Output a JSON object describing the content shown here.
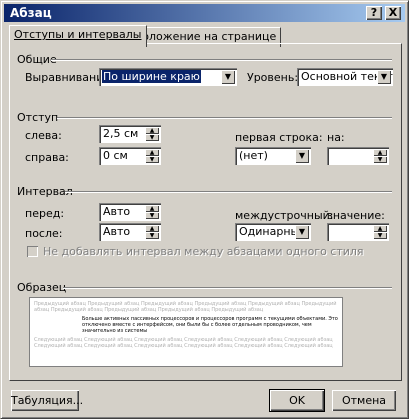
{
  "window": {
    "title": "Абзац",
    "help_btn": "?",
    "close_btn": "X"
  },
  "tabs": [
    {
      "label": "Отступы и интервалы",
      "active": true
    },
    {
      "label": "Положение на странице",
      "active": false
    }
  ],
  "general": {
    "section": "Общие",
    "alignment_label": "Выравнивание:",
    "alignment_value": "По ширине краю",
    "level_label": "Уровень:",
    "level_value": "Основной текст"
  },
  "indent": {
    "section": "Отступ",
    "left_label": "слева:",
    "left_value": "2,5 см",
    "right_label": "справа:",
    "right_value": "0 см",
    "first_line_label": "первая строка:",
    "first_line_value": "(нет)",
    "by_label": "на:",
    "by_value": ""
  },
  "spacing": {
    "section": "Интервал",
    "before_label": "перед:",
    "before_value": "Авто",
    "after_label": "после:",
    "after_value": "Авто",
    "line_label": "междустрочный:",
    "line_value": "Одинарный",
    "at_label": "значение:",
    "at_value": "",
    "no_space_checkbox": "Не добавлять интервал между абзацами одного стиля"
  },
  "preview": {
    "section": "Образец",
    "gray_text": "Предыдущий абзац Предыдущий абзац Предыдущий абзац Предыдущий абзац Предыдущий абзац Предыдущий абзац Предыдущий абзац Предыдущий абзац Предыдущий абзац Предыдущий абзац",
    "black_text": "Больше активных пассивных процессоров и процессоров программ с текущими объектами. Это отключено вместе с интерфейсом, они были бы с более отдельным проводником, чем значительно из системы",
    "gray_text_after": "Следующий абзац Следующий абзац Следующий абзац Следующий абзац Следующий абзац Следующий абзац Следующий абзац Следующий абзац Следующий абзац Следующий абзац Следующий абзац Следующий абзац"
  },
  "buttons": {
    "tabs": "Табуляция...",
    "ok": "OK",
    "cancel": "Отмена"
  }
}
